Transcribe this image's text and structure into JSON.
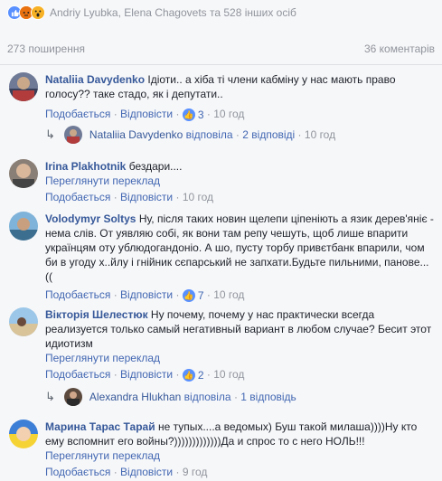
{
  "reactions": {
    "icons": [
      "like-icon",
      "angry-icon",
      "wow-icon"
    ],
    "names": "Andriy Lyubka, Elena Chagovets та 528 інших осіб"
  },
  "stats": {
    "shares": "273 поширення",
    "comments": "36 коментарів"
  },
  "actions": {
    "like": "Подобається",
    "reply": "Відповісти",
    "translate": "Переглянути переклад",
    "separator": "·"
  },
  "comments": [
    {
      "author": "Nataliia Davydenko",
      "text": "Ідіоти.. а хіба ті члени кабміну у нас мають право голосу?? таке стадо, як і депутати..",
      "likes": "3",
      "time": "10 год",
      "reply": {
        "name": "Nataliia Davydenko",
        "verb": "відповіла",
        "count": "2 відповіді",
        "time": "10 год"
      }
    },
    {
      "author": "Irina Plakhotnik",
      "text": "бездари....",
      "time": "10 год"
    },
    {
      "author": "Volodymyr Soltys",
      "text": "Ну, після таких новин щелепи ціпеніють а язик дерев'яніє - нема слів. От уявляю собі, як вони там репу чешуть, щоб лише впарити українцям оту ублюдогандоніо. А шо, пусту торбу привєтбанк впарили, чом би в угоду х..йлу і гнійник сєпарський не запхати.Будьте пильними, панове... ((",
      "likes": "7",
      "time": "10 год"
    },
    {
      "author": "Вікторія Шелестюк",
      "text": "Ну почему, почему у нас практически всегда реализуется только самый негативный вариант в любом случае? Бесит этот идиотизм",
      "likes": "2",
      "time": "10 год",
      "reply": {
        "name": "Alexandra Hlukhan",
        "verb": "відповіла",
        "count": "1 відповідь"
      }
    },
    {
      "author": "Марина Тарас Тарай",
      "text": "не тупых....а ведомых) Буш такой милаша))))Ну кто ему вспомнит его войны?)))))))))))))Да и спрос то с него НОЛЬ!!!",
      "time": "9 год"
    }
  ]
}
